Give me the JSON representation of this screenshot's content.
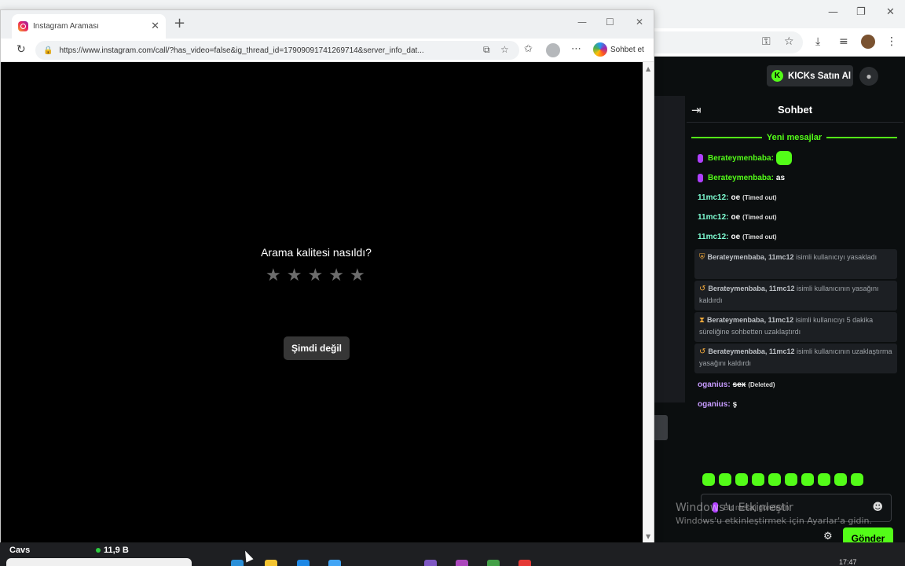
{
  "popup": {
    "tab_title": "Instagram Araması",
    "url": "https://www.instagram.com/call/?has_video=false&ig_thread_id=17909091741269714&server_info_dat...",
    "copilot_label": "Sohbet et"
  },
  "call": {
    "question": "Arama kalitesi nasıldı?",
    "rating_stars": 5,
    "rating_value": 0,
    "dismiss_label": "Şimdi değil"
  },
  "kick": {
    "kicks_button": "KICKs Satın Al",
    "chat_title": "Sohbet",
    "new_messages": "Yeni mesajlar",
    "messages": [
      {
        "user": "Berateymenbaba:",
        "text": ""
      },
      {
        "user": "Berateymenbaba:",
        "text": "as"
      },
      {
        "user": "11mc12:",
        "text": "oe",
        "tag": "(Timed out)"
      },
      {
        "user": "11mc12:",
        "text": "oe",
        "tag": "(Timed out)"
      },
      {
        "user": "11mc12:",
        "text": "oe",
        "tag": "(Timed out)"
      },
      {
        "user": "oganius:",
        "text": "sex",
        "tag": "(Deleted)"
      },
      {
        "user": "oganius:",
        "text": "ş"
      }
    ],
    "mod_events": [
      {
        "actors": "Berateymenbaba, 11mc12",
        "text": "isimli kullanıcıyı yasakladı"
      },
      {
        "actors": "Berateymenbaba, 11mc12",
        "text": "isimli kullanıcının yasağını kaldırdı"
      },
      {
        "actors": "Berateymenbaba, 11mc12",
        "text": "isimli kullanıcıyı 5 dakika süreliğine sohbetten uzaklaştırdı"
      },
      {
        "actors": "Berateymenbaba, 11mc12",
        "text": "isimli kullanıcının uzaklaştırma yasağını kaldırdı"
      }
    ],
    "input_placeholder": "Bir mesaj gönderin",
    "send_label": "Gönder"
  },
  "watermark": {
    "line1": "Windows'u Etkinleştir",
    "line2": "Windows'u etkinleştirmek için Ayarlar'a gidin."
  },
  "taskbar": {
    "stock_name": "Cavs",
    "stock_value": "11,9 B",
    "clock": "17:47"
  },
  "colors": {
    "kick_green": "#53fc18",
    "ig_gradient": "#e91e63",
    "moderation_orange": "#f2a93b"
  }
}
